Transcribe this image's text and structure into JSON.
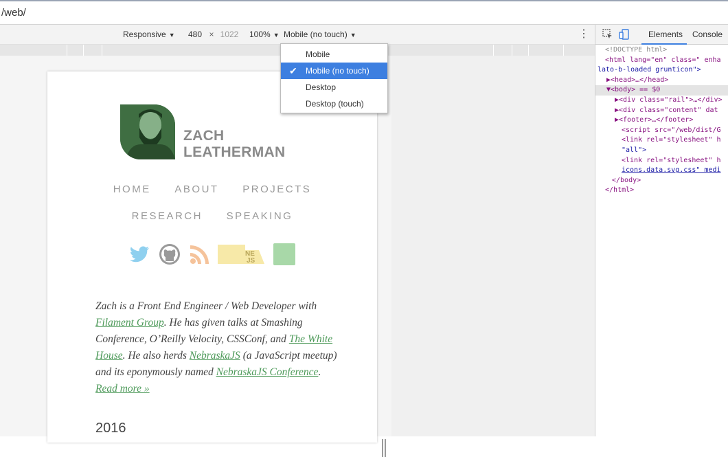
{
  "address_bar": {
    "url": "/web/"
  },
  "device_toolbar": {
    "mode": "Responsive",
    "width": "480",
    "times": "×",
    "height": "1022",
    "zoom": "100%",
    "throttle": "Mobile (no touch)"
  },
  "device_menu": {
    "items": [
      {
        "label": "Mobile",
        "selected": false
      },
      {
        "label": "Mobile (no touch)",
        "selected": true
      },
      {
        "label": "Desktop",
        "selected": false
      },
      {
        "label": "Desktop (touch)",
        "selected": false
      }
    ]
  },
  "site": {
    "name_line1": "ZACH",
    "name_line2": "LEATHERMAN",
    "nav_row1": [
      "HOME",
      "ABOUT",
      "PROJECTS"
    ],
    "nav_row2": [
      "RESEARCH",
      "SPEAKING"
    ],
    "social_icons": [
      "twitter-icon",
      "github-icon",
      "rss-icon",
      "nebraskajs-icon",
      "filament-icon"
    ],
    "nebraskajs_text": "NE JS",
    "bio": {
      "t1": "Zach is a Front End Engineer / Web Developer with ",
      "link1": "Filament Group",
      "t2": ". He has given talks at Smashing Conference, O’Reilly Velocity, CSSConf, and ",
      "link2": "The White House",
      "t3": ". He also herds ",
      "link3": "NebraskaJS",
      "t4": " (a JavaScript meetup) and its eponymously named ",
      "link4": "NebraskaJS Conference",
      "t5": ".",
      "read_more": "Read more »"
    },
    "year": "2016",
    "colors": {
      "accent_green": "#4e9a5a",
      "avatar_green": "#3f6e42"
    }
  },
  "devtools": {
    "tabs": [
      "Elements",
      "Console"
    ],
    "lines": [
      {
        "text": "<!DOCTYPE html>"
      },
      {
        "text": "<html lang=\"en\" class=\" enha"
      },
      {
        "text": "lato-b-loaded grunticon\">"
      },
      {
        "text": "▶<head>…</head>"
      },
      {
        "text": "▼<body> == $0"
      },
      {
        "text": "▶<div class=\"rail\">…</div>"
      },
      {
        "text": "▶<div class=\"content\" dat"
      },
      {
        "text": "▶<footer>…</footer>"
      },
      {
        "text": "<script src=\"/web/dist/G"
      },
      {
        "text": "<link rel=\"stylesheet\" h"
      },
      {
        "text": "\"all\">"
      },
      {
        "text": "<link rel=\"stylesheet\" h"
      },
      {
        "text": "icons.data.svg.css\" medi"
      },
      {
        "text": "</body>"
      },
      {
        "text": "</html>"
      }
    ]
  }
}
